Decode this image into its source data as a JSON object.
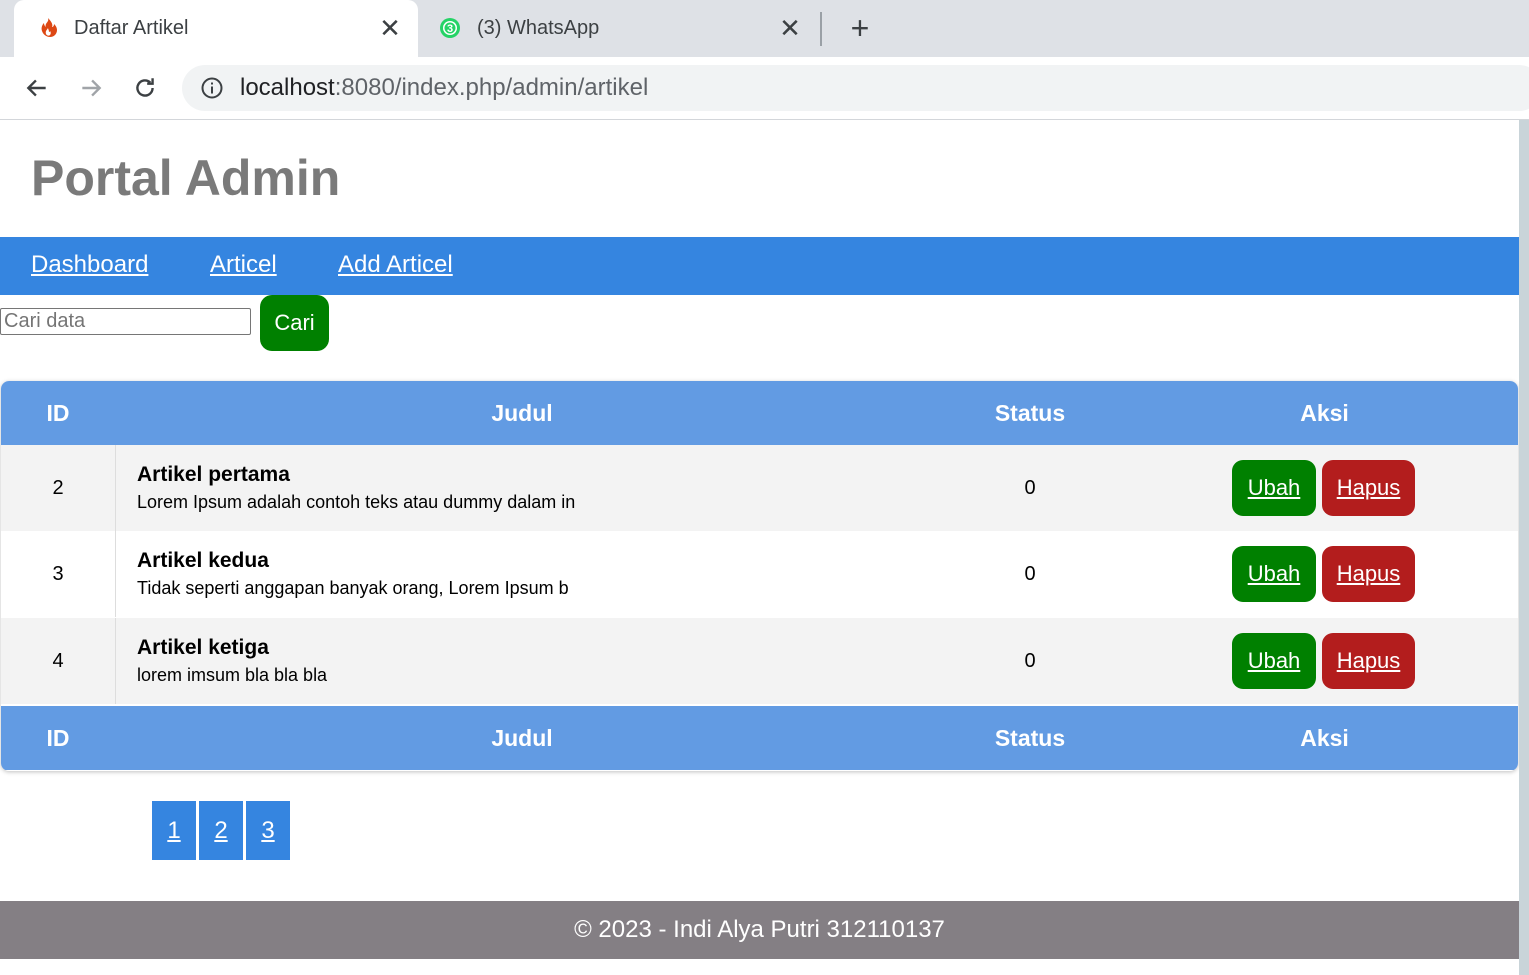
{
  "browser": {
    "tabs": [
      {
        "title": "Daftar Artikel",
        "icon": "codeigniter-flame-icon",
        "active": true
      },
      {
        "title": "(3) WhatsApp",
        "icon": "whatsapp-icon",
        "badge": "3",
        "active": false
      }
    ],
    "url_host": "localhost",
    "url_path": ":8080/index.php/admin/artikel"
  },
  "site": {
    "title": "Portal Admin"
  },
  "nav": {
    "dashboard": "Dashboard",
    "articel": "Articel",
    "add_articel": "Add Articel"
  },
  "search": {
    "placeholder": "Cari data",
    "value": "",
    "button": "Cari"
  },
  "table": {
    "headers": {
      "id": "ID",
      "judul": "Judul",
      "status": "Status",
      "aksi": "Aksi"
    },
    "rows": [
      {
        "id": "2",
        "title": "Artikel pertama",
        "excerpt": "Lorem Ipsum adalah contoh teks atau dummy dalam in",
        "status": "0",
        "edit": "Ubah",
        "delete": "Hapus"
      },
      {
        "id": "3",
        "title": "Artikel kedua",
        "excerpt": "Tidak seperti anggapan banyak orang, Lorem Ipsum b",
        "status": "0",
        "edit": "Ubah",
        "delete": "Hapus"
      },
      {
        "id": "4",
        "title": "Artikel ketiga",
        "excerpt": "lorem imsum bla bla bla",
        "status": "0",
        "edit": "Ubah",
        "delete": "Hapus"
      }
    ]
  },
  "pagination": [
    "1",
    "2",
    "3"
  ],
  "footer": {
    "text": "© 2023 - Indi Alya Putri 312110137"
  },
  "colors": {
    "nav_bar": "#3585e0",
    "table_header": "#629be3",
    "button_green": "#008000",
    "button_red": "#b31d1d",
    "footer": "#847f84"
  }
}
